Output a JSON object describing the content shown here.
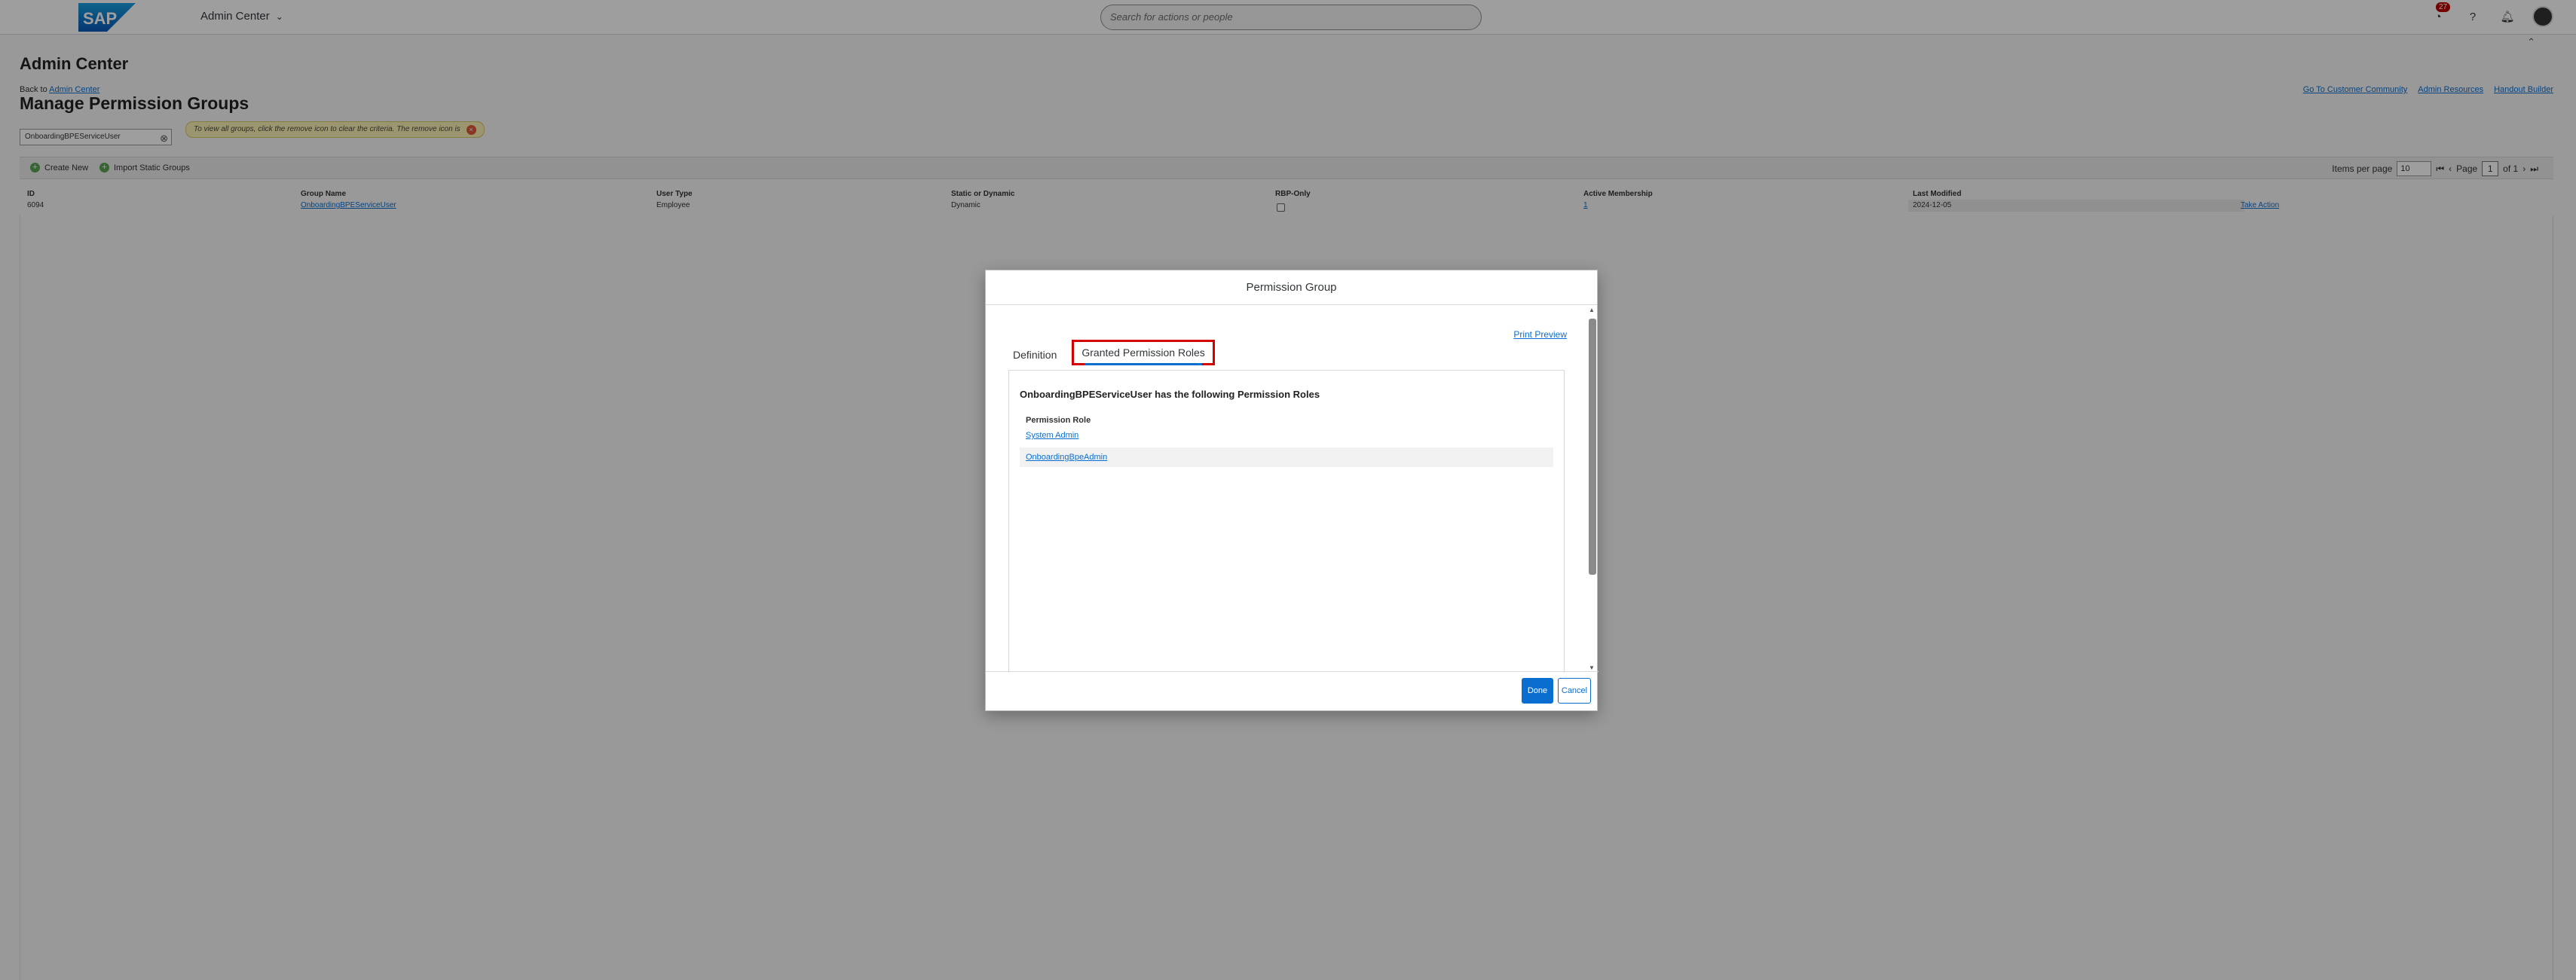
{
  "shell": {
    "logo_text": "SAP",
    "app_title": "Admin Center",
    "search_placeholder": "Search for actions or people",
    "notification_count": "27"
  },
  "header": {
    "title": "Admin Center",
    "back_prefix": "Back to",
    "back_link": "Admin Center",
    "page_heading": "Manage Permission Groups",
    "links": [
      "Go To Customer Community",
      "Admin Resources",
      "Handout Builder"
    ]
  },
  "filter": {
    "value": "OnboardingBPEServiceUser",
    "hint": "To view all groups, click the remove icon to clear the criteria. The remove icon is"
  },
  "toolbar": {
    "create_new": "Create New",
    "import_static": "Import Static Groups",
    "items_per_page_label": "Items per page",
    "items_per_page_value": "10",
    "page_label": "Page",
    "page_value": "1",
    "page_of": "of 1"
  },
  "table": {
    "headers": [
      "ID",
      "Group Name",
      "User Type",
      "Static or Dynamic",
      "RBP-Only",
      "Active Membership",
      "Last Modified"
    ],
    "row": {
      "id": "6094",
      "group_name": "OnboardingBPEServiceUser",
      "user_type": "Employee",
      "static_dynamic": "Dynamic",
      "active_membership": "1",
      "last_modified": "2024-12-05",
      "action": "Take Action"
    }
  },
  "dialog": {
    "title": "Permission Group",
    "print_preview": "Print Preview",
    "tabs": [
      "Definition",
      "Granted Permission Roles"
    ],
    "content_title": "OnboardingBPEServiceUser has the following Permission Roles",
    "role_header": "Permission Role",
    "roles": [
      "System Admin",
      "OnboardingBpeAdmin"
    ],
    "done": "Done",
    "cancel": "Cancel"
  },
  "colors": {
    "accent": "#0a6ed1",
    "highlight_border": "#d40000",
    "badge": "#bb0000"
  }
}
